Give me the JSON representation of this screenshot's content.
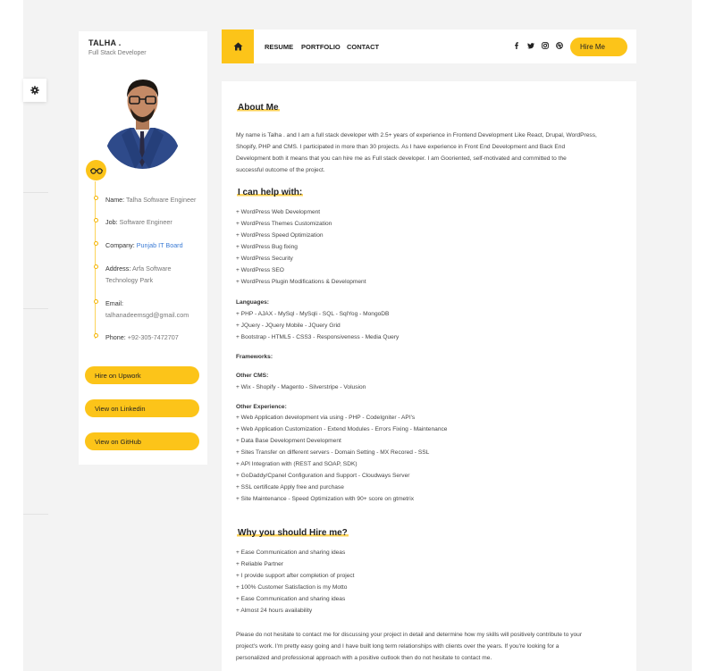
{
  "sidebar": {
    "name": "TALHA .",
    "role": "Full Stack Developer",
    "info": [
      {
        "label": "Name:",
        "value": "Talha Software Engineer",
        "link": false
      },
      {
        "label": "Job:",
        "value": "Software Engineer",
        "link": false
      },
      {
        "label": "Company:",
        "value": "Punjab IT Board",
        "link": true
      },
      {
        "label": "Address:",
        "value": "Arfa Software Technology Park",
        "link": false
      },
      {
        "label": "Email:",
        "value": "talhanadeemsgd@gmail.com",
        "link": false
      },
      {
        "label": "Phone:",
        "value": "+92-305-7472707",
        "link": false
      }
    ],
    "buttons": [
      "Hire on Upwork",
      "View on Linkedin",
      "View on GitHub"
    ]
  },
  "nav": {
    "links": [
      "RESUME",
      "PORTFOLIO",
      "CONTACT"
    ],
    "social_icons": [
      "facebook-icon",
      "twitter-icon",
      "instagram-icon",
      "dribbble-icon"
    ],
    "hire_label": "Hire Me"
  },
  "main": {
    "about_title": "About Me",
    "about_lines": [
      "My name is Talha . and I am a full stack developer with 2.5+ years of experience in Frontend Development Like React, Drupal, WordPress,",
      "Shopify, PHP and CMS. I participated in more than 30 projects. As I have experience in Front End Development and Back End",
      "Development both it means that you can hire me as Full stack developer. I am Gooriented, self-motivated and committed to the",
      "successful outcome of the project."
    ],
    "help_title": "I can help with:",
    "help_items": [
      "+ WordPress Web Development",
      "+ WordPress Themes Customization",
      "+ WordPress Speed Optimization",
      "+ WordPress Bug fixing",
      "+ WordPress Security",
      "+ WordPress SEO",
      "+ WordPress Plugin Modifications & Development"
    ],
    "languages_title": "Languages:",
    "languages": [
      "+ PHP - AJAX - MySql - MySqli - SQL - SqlYog - MongoDB",
      "+ JQuery - JQuery Mobile - JQuery Grid",
      "+ Bootstrap - HTML5 - CSS3 - Responsiveness - Media Query"
    ],
    "frameworks_title": "Frameworks:",
    "cms_title": "Other CMS:",
    "cms": [
      "+ Wix - Shopify - Magento - Silverstripe - Volusion"
    ],
    "experience_title": "Other Experience:",
    "experience": [
      "+ Web Application development via using - PHP - CodeIgniter - API's",
      "+ Web Application Customization - Extend Modules - Errors Fixing - Maintenance",
      "+ Data Base Development Development",
      "+ Sites Transfer on different servers - Domain Setting - MX Recored - SSL",
      "+ API Integration with (REST and SOAP, SDK)",
      "+ GoDaddy/Cpanel Configuration and Support - Cloudways Server",
      "+ SSL certificate Apply free and purchase",
      "+ Site Maintenance - Speed Optimization with 90+ score on gtmetrix"
    ],
    "why_title": "Why you should Hire me?",
    "why_items": [
      "+ Ease Communication and sharing ideas",
      "+ Reliable Partner",
      "+ I provide support after completion of project",
      "+ 100% Customer Satisfaction is my Motto",
      "+ Ease Communication and sharing ideas",
      "+ Almost 24 hours availability"
    ],
    "closing_lines": [
      "Please do not hesitate to contact me for discussing your project in detail and determine how my skills will positively contribute to your",
      "project's work. I'm pretty easy going and I have built long term relationships with clients over the years. If you're looking for a",
      "personalized and professional approach with a positive outlook then do not hesitate to contact me."
    ]
  },
  "colors": {
    "accent": "#fcc419",
    "link": "#3a7bd5",
    "background": "#f3f3f3"
  }
}
